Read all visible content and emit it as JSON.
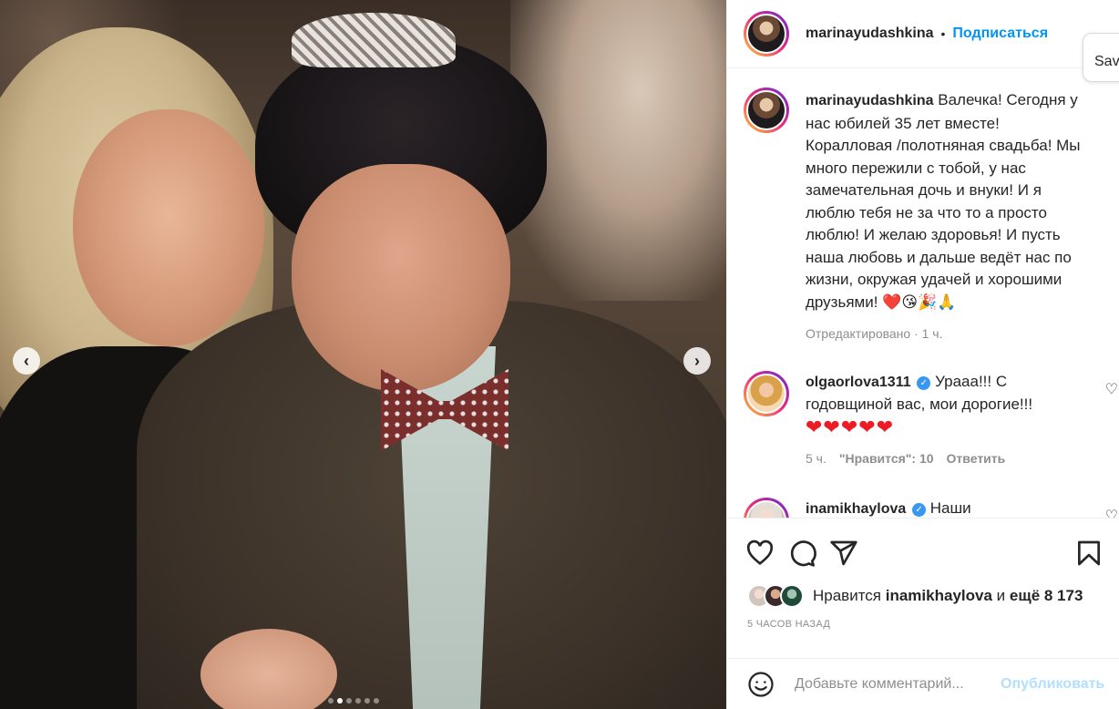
{
  "post": {
    "carousel": {
      "total_slides": 6,
      "active_slide": 2
    }
  },
  "header": {
    "username": "marinayudashkina",
    "separator": "•",
    "follow_label": "Подписаться",
    "save_label": "Sav"
  },
  "caption": {
    "username": "marinayudashkina",
    "text": "Валечка! Сегодня у нас юбилей 35 лет вместе! Коралловая /полотняная свадьба! Мы много пережили с тобой, у нас замечательная дочь и внуки! И я люблю тебя не за что то а просто люблю! И желаю здоровья! И пусть наша любовь и дальше ведёт нас по жизни, окружая удачей и хорошими друзьями! ❤️😘🎉🙏",
    "edited": "Отредактировано · 1 ч."
  },
  "comments": [
    {
      "username": "olgaorlova1311",
      "verified": true,
      "text": "Урааа!!! С годовщиной вас, мои дорогие!!!",
      "hearts": "❤❤❤❤❤",
      "time": "5 ч.",
      "likes": "\"Нравится\": 10",
      "reply": "Ответить"
    },
    {
      "username": "inamikhaylova",
      "verified": true,
      "text": "Наши"
    }
  ],
  "likes": {
    "prefix": "Нравится",
    "user": "inamikhaylova",
    "middle": "и",
    "rest": "ещё 8 173"
  },
  "time_ago": "5 ЧАСОВ НАЗАД",
  "add_comment": {
    "placeholder": "Добавьте комментарий...",
    "publish": "Опубликовать"
  },
  "icons": {
    "nav_left": "chevron-left-icon",
    "nav_right": "chevron-right-icon",
    "like": "heart-icon",
    "comment": "comment-icon",
    "share": "share-icon",
    "save": "bookmark-icon",
    "emoji": "emoji-icon"
  },
  "colors": {
    "accent": "#0095f6",
    "publish_disabled": "#b2dffc",
    "muted": "#8e8e8e",
    "verified": "#3897f0"
  }
}
